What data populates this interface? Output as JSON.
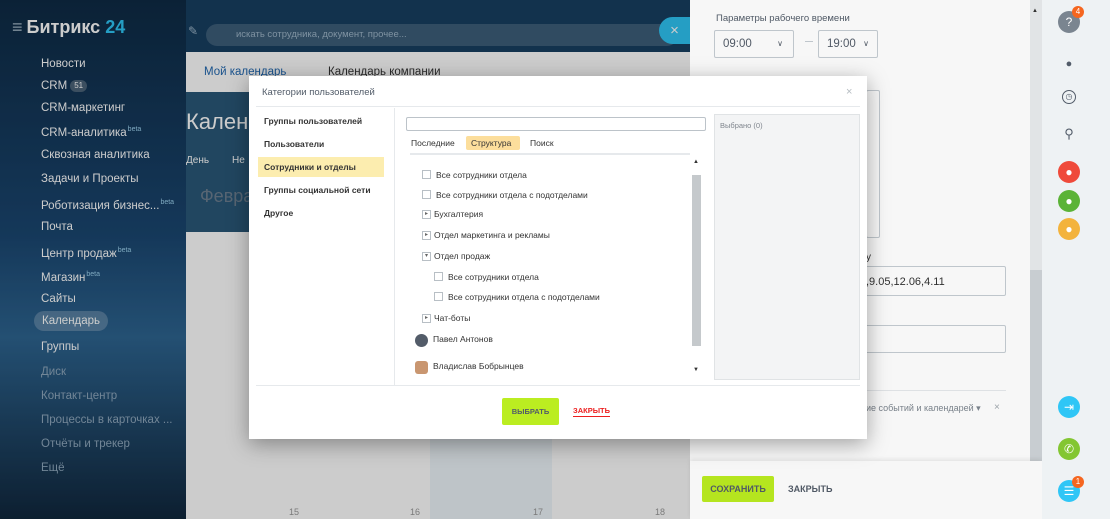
{
  "sidebar": {
    "logo_text": "Битрикс",
    "logo_num": "24",
    "items": [
      {
        "label": "Новости"
      },
      {
        "label": "CRM",
        "badge": "51"
      },
      {
        "label": "CRM-маркетинг"
      },
      {
        "label": "CRM-аналитика",
        "sup": "beta"
      },
      {
        "label": "Сквозная аналитика"
      },
      {
        "label": "Задачи и Проекты"
      },
      {
        "label": "Роботизация бизнес...",
        "sup": "beta"
      },
      {
        "label": "Почта"
      },
      {
        "label": "Центр продаж",
        "sup": "beta"
      },
      {
        "label": "Магазин",
        "sup": "beta"
      },
      {
        "label": "Сайты"
      },
      {
        "label": "Календарь"
      },
      {
        "label": "Группы"
      },
      {
        "label": "Диск"
      },
      {
        "label": "Контакт-центр"
      },
      {
        "label": "Процессы в карточках ..."
      },
      {
        "label": "Отчёты и трекер"
      },
      {
        "label": "Ещё"
      }
    ]
  },
  "header": {
    "search_placeholder": "искать сотрудника, документ, прочее...",
    "close_label": "×"
  },
  "calendar": {
    "tabs": [
      "Мой календарь",
      "Календарь компании"
    ],
    "title": "Кален",
    "view_day": "День",
    "view_more": "Не",
    "month_fragment": "Февра",
    "day_numbers": [
      "15",
      "16",
      "17",
      "18"
    ]
  },
  "slider": {
    "work_time_label": "Параметры рабочего времени",
    "time_from": "09:00",
    "time_to": "19:00",
    "fragment_u": "у",
    "dates_value": ",9.05,12.06,4.11",
    "events_text": "ие событий и календарей ▾",
    "events_close": "×",
    "save_label": "СОХРАНИТЬ",
    "close_label": "ЗАКРЫТЬ"
  },
  "dialog": {
    "title": "Категории пользователей",
    "close": "×",
    "categories": [
      "Группы пользователей",
      "Пользователи",
      "Сотрудники и отделы",
      "Группы социальной сети",
      "Другое"
    ],
    "active_category": "Сотрудники и отделы",
    "sub_tabs": [
      "Последние",
      "Структура",
      "Поиск"
    ],
    "active_sub_tab": "Структура",
    "tree": {
      "all_dept": "Все сотрудники отдела",
      "all_dept_sub": "Все сотрудники отдела с подотделами",
      "accounting": "Бухгалтерия",
      "marketing": "Отдел маркетинга и рекламы",
      "sales": "Отдел продаж",
      "sales_all": "Все сотрудники отдела",
      "sales_all_sub": "Все сотрудники отдела с подотделами",
      "chatbots": "Чат-боты",
      "user1": "Павел Антонов",
      "user2": "Владислав Бобрынцев"
    },
    "selected_label": "Выбрано (0)",
    "choose_label": "ВЫБРАТЬ",
    "close_label": "ЗАКРЫТЬ"
  },
  "right_bar": {
    "help_badge": "4",
    "chat_badge": "1"
  },
  "colors": {
    "accent_green": "#bbed21",
    "accent_blue": "#2fc6f6",
    "highlight_yellow": "#fcedaf",
    "danger_red": "#ec1f1f"
  }
}
